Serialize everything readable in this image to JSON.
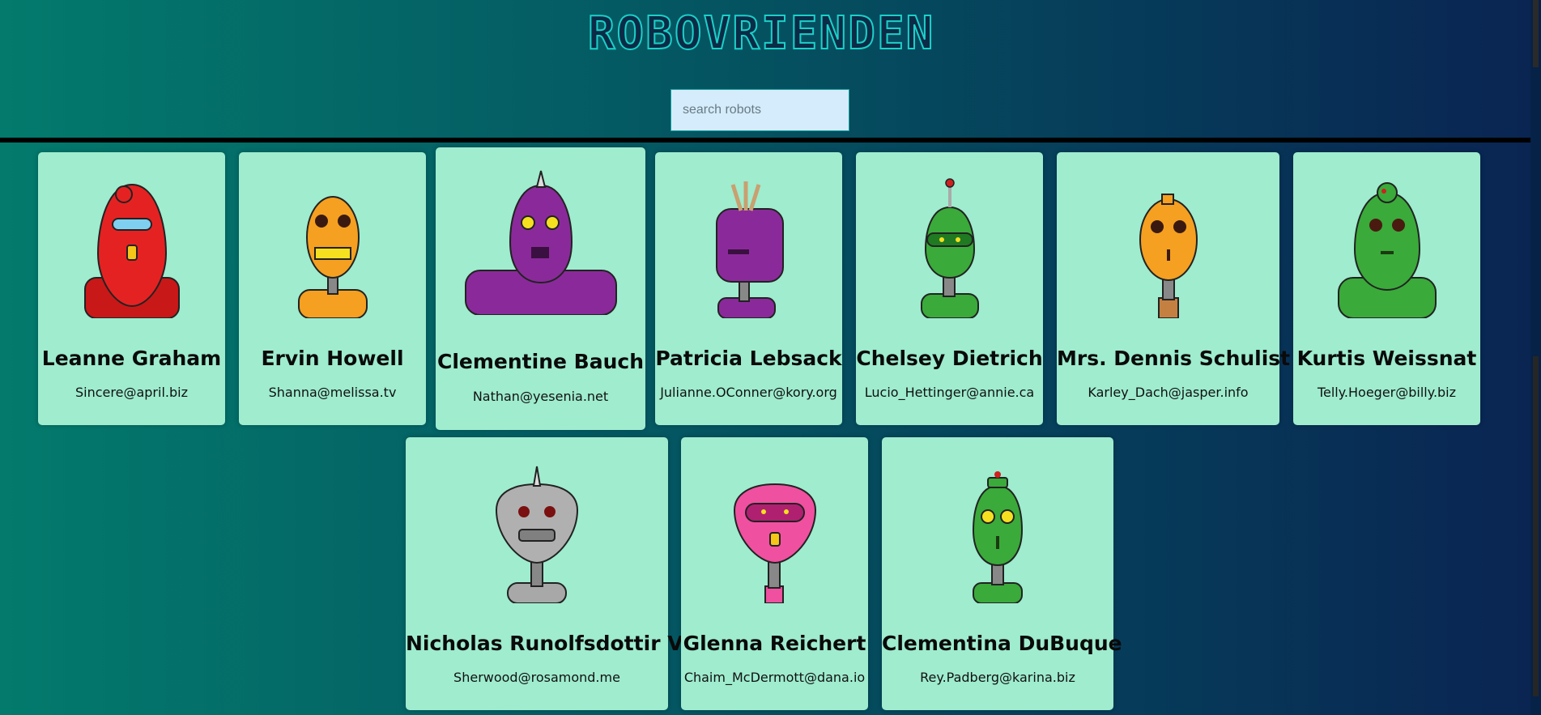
{
  "app": {
    "title": "ROBOVRIENDEN"
  },
  "search": {
    "placeholder": "search robots"
  },
  "robots": [
    {
      "name": "Leanne Graham",
      "email": "Sincere@april.biz",
      "color": "#e02020",
      "icon": "red-robot-icon"
    },
    {
      "name": "Ervin Howell",
      "email": "Shanna@melissa.tv",
      "color": "#f5a020",
      "icon": "orange-robot-icon"
    },
    {
      "name": "Clementine Bauch",
      "email": "Nathan@yesenia.net",
      "color": "#8a2a9a",
      "icon": "purple-robot-icon"
    },
    {
      "name": "Patricia Lebsack",
      "email": "Julianne.OConner@kory.org",
      "color": "#8a2a9a",
      "icon": "purple-robot-icon"
    },
    {
      "name": "Chelsey Dietrich",
      "email": "Lucio_Hettinger@annie.ca",
      "color": "#3aaa3a",
      "icon": "green-robot-icon"
    },
    {
      "name": "Mrs. Dennis Schulist",
      "email": "Karley_Dach@jasper.info",
      "color": "#f5a020",
      "icon": "orange-robot-icon"
    },
    {
      "name": "Kurtis Weissnat",
      "email": "Telly.Hoeger@billy.biz",
      "color": "#3aaa3a",
      "icon": "green-robot-icon"
    },
    {
      "name": "Nicholas Runolfsdottir V",
      "email": "Sherwood@rosamond.me",
      "color": "#a8a8a8",
      "icon": "gray-robot-icon"
    },
    {
      "name": "Glenna Reichert",
      "email": "Chaim_McDermott@dana.io",
      "color": "#f050a0",
      "icon": "pink-robot-icon"
    },
    {
      "name": "Clementina DuBuque",
      "email": "Rey.Padberg@karina.biz",
      "color": "#3aaa3a",
      "icon": "green-robot-icon"
    }
  ]
}
